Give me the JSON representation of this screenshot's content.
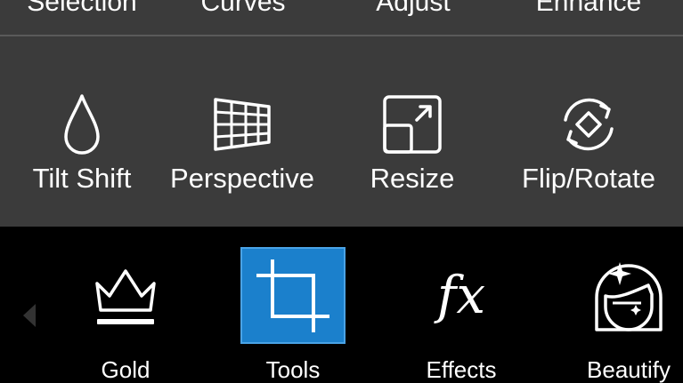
{
  "top_tabs": [
    "Selection",
    "Curves",
    "Adjust",
    "Enhance"
  ],
  "tools": [
    {
      "label": "Tilt Shift",
      "icon": "drop-icon"
    },
    {
      "label": "Perspective",
      "icon": "perspective-grid-icon"
    },
    {
      "label": "Resize",
      "icon": "resize-icon"
    },
    {
      "label": "Flip/Rotate",
      "icon": "flip-rotate-icon"
    }
  ],
  "bottom_nav": {
    "back_icon": "chevron-left-icon",
    "items": [
      {
        "label": "Gold",
        "icon": "crown-icon"
      },
      {
        "label": "Tools",
        "icon": "crop-icon",
        "active": true
      },
      {
        "label": "Effects",
        "icon": "fx-icon"
      },
      {
        "label": "Beautify",
        "icon": "face-sparkle-icon"
      }
    ]
  },
  "colors": {
    "panel": "#3b3b3b",
    "bottom": "#000000",
    "accent": "#1b80cc",
    "text": "#ffffff"
  }
}
